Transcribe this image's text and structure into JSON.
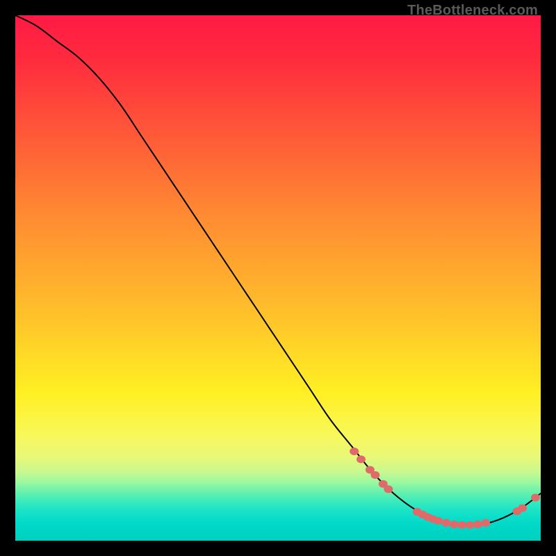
{
  "watermark": "TheBottleneck.com",
  "colors": {
    "frame_bg": "#000000",
    "curve": "#000000",
    "dot": "#e06a6a"
  },
  "chart_data": {
    "type": "line",
    "title": "",
    "xlabel": "",
    "ylabel": "",
    "xlim": [
      0,
      100
    ],
    "ylim": [
      0,
      100
    ],
    "series": [
      {
        "name": "curve",
        "x": [
          0,
          4,
          8,
          12,
          16,
          20,
          24,
          28,
          32,
          36,
          40,
          44,
          48,
          52,
          56,
          60,
          64,
          68,
          72,
          76,
          80,
          84,
          88,
          92,
          96,
          100
        ],
        "y": [
          100,
          98,
          95,
          92,
          88,
          83,
          77,
          71,
          65,
          59,
          53,
          47,
          41,
          35,
          29,
          23,
          18,
          13,
          9,
          6,
          4,
          3,
          3,
          4,
          6,
          9
        ]
      }
    ],
    "markers": [
      {
        "x": 64.5,
        "y": 17.0
      },
      {
        "x": 65.8,
        "y": 15.5
      },
      {
        "x": 67.5,
        "y": 13.5
      },
      {
        "x": 68.5,
        "y": 12.5
      },
      {
        "x": 70.0,
        "y": 10.8
      },
      {
        "x": 71.0,
        "y": 9.8
      },
      {
        "x": 76.5,
        "y": 5.5
      },
      {
        "x": 77.5,
        "y": 5.0
      },
      {
        "x": 78.5,
        "y": 4.5
      },
      {
        "x": 79.5,
        "y": 4.1
      },
      {
        "x": 80.5,
        "y": 3.8
      },
      {
        "x": 82.0,
        "y": 3.4
      },
      {
        "x": 83.5,
        "y": 3.1
      },
      {
        "x": 85.0,
        "y": 3.0
      },
      {
        "x": 86.5,
        "y": 3.0
      },
      {
        "x": 88.0,
        "y": 3.1
      },
      {
        "x": 89.5,
        "y": 3.4
      },
      {
        "x": 95.5,
        "y": 5.6
      },
      {
        "x": 96.5,
        "y": 6.2
      },
      {
        "x": 99.0,
        "y": 8.2
      }
    ]
  }
}
